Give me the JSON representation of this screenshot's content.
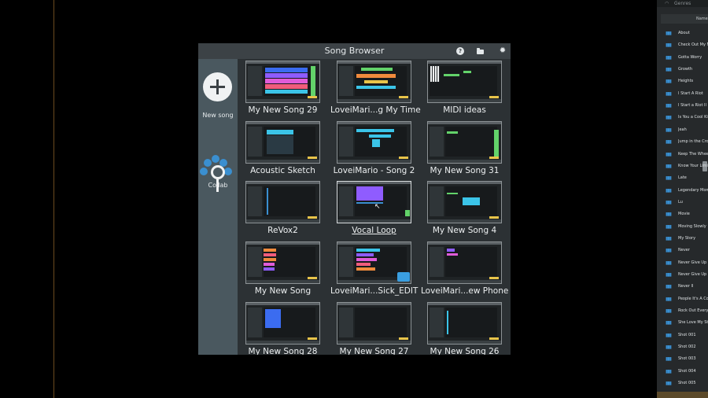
{
  "browser": {
    "title": "Song Browser",
    "icons": {
      "help": "help-icon",
      "folder": "folder-icon",
      "settings": "gear-icon"
    }
  },
  "sidebar": {
    "new_song_label": "New song",
    "collab_label": "Collab"
  },
  "songs": [
    {
      "name": "My New Song 29"
    },
    {
      "name": "LoveiMari...g My Time"
    },
    {
      "name": "MIDI ideas"
    },
    {
      "name": "Acoustic Sketch"
    },
    {
      "name": "LoveiMario - Song 2"
    },
    {
      "name": "My New Song 31"
    },
    {
      "name": "ReVox2"
    },
    {
      "name": "Vocal Loop",
      "selected": true
    },
    {
      "name": "My New Song 4"
    },
    {
      "name": "My New Song"
    },
    {
      "name": "LoveiMari...Sick_EDIT"
    },
    {
      "name": "LoveiMari...ew Phone"
    },
    {
      "name": "My New Song 28"
    },
    {
      "name": "My New Song 27"
    },
    {
      "name": "My New Song 26"
    }
  ],
  "genres": {
    "header": "Genres",
    "column": "Name",
    "items": [
      "About",
      "Check Out My Ne",
      "Gotta Worry",
      "Growth",
      "Heights",
      "I Start A Riot",
      "I Start a Riot II",
      "Is You a Cool Kid",
      "Jeah",
      "Jump in the Crow",
      "Keep The Wheels",
      "Know Your Limit",
      "Late",
      "Legendary Mom",
      "Lu",
      "Movie",
      "Moving Slowly",
      "My Story",
      "Never",
      "Never Give Up",
      "Never Give Up II",
      "Never II",
      "People It's A Cor",
      "Rock Out Every",
      "She Love My Style",
      "Shot 001",
      "Shot 002",
      "Shot 003",
      "Shot 004",
      "Shot 005"
    ]
  },
  "colors": {
    "accent": "#3a8fd0",
    "window": "#2c3134",
    "sidebar": "#4a585f",
    "track_purple": "#8f5cff",
    "track_cyan": "#3bc4e8",
    "track_green": "#63d36a",
    "track_orange": "#f08a3c"
  }
}
